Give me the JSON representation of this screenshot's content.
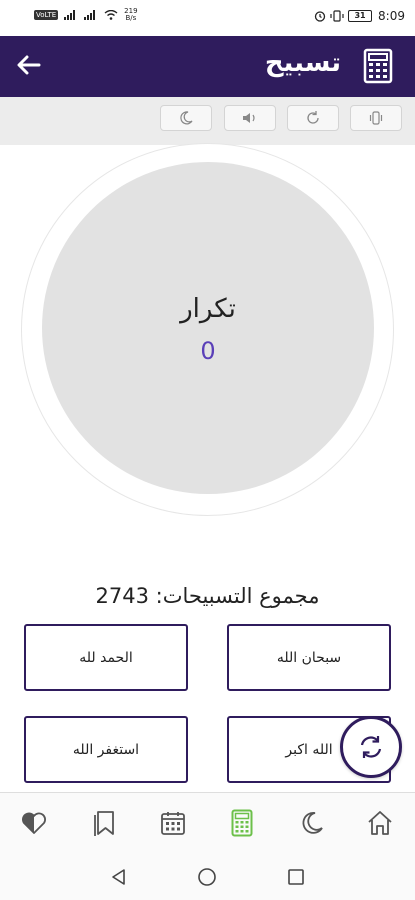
{
  "status_bar": {
    "carrier_badge": "VoLTE",
    "speed_value": "219",
    "speed_unit": "B/s",
    "battery": "31",
    "time": "8:09"
  },
  "app_bar": {
    "title": "تسبيح"
  },
  "counter": {
    "label": "تكرار",
    "value": "0"
  },
  "total": {
    "text": "مجموع التسبيحات: 2743"
  },
  "zikr_buttons": [
    {
      "label": "سبحان الله"
    },
    {
      "label": "الحمد لله"
    },
    {
      "label": "الله اكبر"
    },
    {
      "label": "استغفر الله"
    }
  ],
  "colors": {
    "primary": "#2f1c5d",
    "counter_value": "#5a3fb8",
    "nav_active": "#6cc04a"
  },
  "bottom_nav": [
    {
      "icon": "home-icon"
    },
    {
      "icon": "moon-icon"
    },
    {
      "icon": "calculator-icon",
      "active": true
    },
    {
      "icon": "calendar-icon"
    },
    {
      "icon": "bookmark-icon"
    },
    {
      "icon": "heart-icon"
    }
  ]
}
